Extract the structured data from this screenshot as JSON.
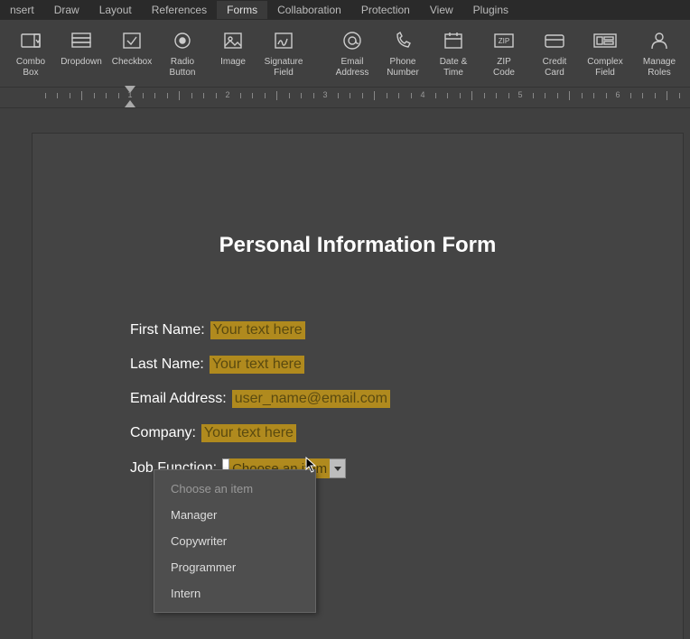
{
  "menubar": {
    "items": [
      {
        "label": "Insert",
        "trunc": "nsert"
      },
      {
        "label": "Draw"
      },
      {
        "label": "Layout"
      },
      {
        "label": "References"
      },
      {
        "label": "Forms",
        "active": true
      },
      {
        "label": "Collaboration"
      },
      {
        "label": "Protection"
      },
      {
        "label": "View"
      },
      {
        "label": "Plugins"
      }
    ]
  },
  "ribbon": {
    "tools": [
      {
        "name": "combo-box",
        "label_l1": "Combo",
        "label_l2": "Box"
      },
      {
        "name": "dropdown",
        "label_l1": "Dropdown",
        "label_l2": ""
      },
      {
        "name": "checkbox",
        "label_l1": "Checkbox",
        "label_l2": ""
      },
      {
        "name": "radio-button",
        "label_l1": "Radio",
        "label_l2": "Button"
      },
      {
        "name": "image",
        "label_l1": "Image",
        "label_l2": ""
      },
      {
        "name": "signature-field",
        "label_l1": "Signature",
        "label_l2": "Field"
      },
      {
        "name": "email-address",
        "label_l1": "Email",
        "label_l2": "Address"
      },
      {
        "name": "phone-number",
        "label_l1": "Phone",
        "label_l2": "Number"
      },
      {
        "name": "date-time",
        "label_l1": "Date &",
        "label_l2": "Time"
      },
      {
        "name": "zip-code",
        "label_l1": "ZIP",
        "label_l2": "Code"
      },
      {
        "name": "credit-card",
        "label_l1": "Credit",
        "label_l2": "Card"
      },
      {
        "name": "complex-field",
        "label_l1": "Complex",
        "label_l2": "Field"
      },
      {
        "name": "manage-roles",
        "label_l1": "Manage",
        "label_l2": "Roles",
        "last": true
      }
    ]
  },
  "ruler": {
    "majors": [
      1,
      2,
      3,
      4,
      5
    ]
  },
  "document": {
    "title": "Personal Information Form",
    "fields": {
      "first_name": {
        "label": "First Name:",
        "placeholder": "Your text here"
      },
      "last_name": {
        "label": "Last Name:",
        "placeholder": "Your text here"
      },
      "email": {
        "label": "Email Address:",
        "placeholder": "user_name@email.com"
      },
      "company": {
        "label": "Company:",
        "placeholder": "Your text here"
      },
      "job_function": {
        "label": "Job Function:",
        "selected": "Choose an item",
        "options": [
          "Choose an item",
          "Manager",
          "Copywriter",
          "Programmer",
          "Intern"
        ]
      }
    }
  }
}
